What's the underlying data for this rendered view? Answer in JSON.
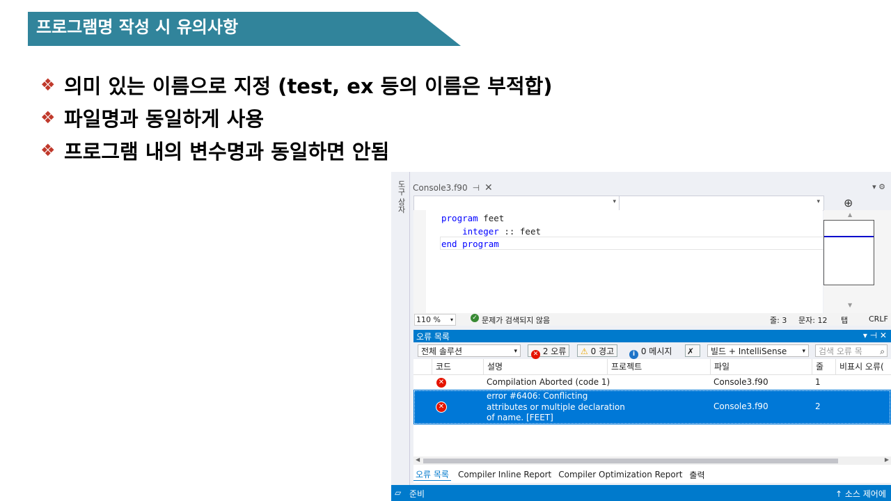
{
  "slide": {
    "title": "프로그램명 작성 시 유의사항",
    "bullets": [
      "의미 있는 이름으로 지정 (test, ex 등의 이름은 부적합)",
      "파일명과 동일하게 사용",
      "프로그램 내의 변수명과 동일하면 안됨"
    ],
    "bullet_icon": "❖",
    "colors": {
      "banner": "#31849b",
      "bullet": "#c0392b"
    }
  },
  "ide": {
    "side_tab_label": "도구 상자",
    "doc_tab": {
      "title": "Console3.f90",
      "pin": "⊣",
      "close": "✕"
    },
    "window_controls": "▾ ⚙",
    "split_button": "⊕",
    "code_lines": [
      {
        "kw": "program",
        "rest": " feet"
      },
      {
        "kw": "integer",
        "rest": " :: feet"
      },
      {
        "kw": "end program",
        "rest": ""
      }
    ],
    "zoom": "110 %",
    "status_ok": "문제가 검색되지 않음",
    "line": "줄: 3",
    "col": "문자: 12",
    "tab": "탭",
    "eol": "CRLF",
    "error_list": {
      "title": "오류 목록",
      "title_controls": "▾ ⊣ ✕",
      "scope": "전체 솔루션",
      "errors_btn": "2 오류",
      "warnings_btn": "0 경고",
      "messages_btn": "0 메시지",
      "build_filter": "빌드 + IntelliSense",
      "search_placeholder": "검색 오류 목",
      "columns": [
        "코드",
        "설명",
        "프로젝트",
        "파일",
        "줄",
        "비표시 오류("
      ],
      "rows": [
        {
          "desc": "Compilation Aborted (code 1)",
          "file": "Console3.f90",
          "line": "1"
        },
        {
          "desc_lines": [
            "error #6406: Conflicting",
            "attributes or multiple declaration",
            "of name.   [FEET]"
          ],
          "file": "Console3.f90",
          "line": "2"
        }
      ]
    },
    "bottom_tabs": [
      "오류 목록",
      "Compiler Inline Report",
      "Compiler Optimization Report",
      "출력"
    ],
    "status_bar": {
      "ready": "준비",
      "source_control": "↑  소스 제어에"
    }
  }
}
